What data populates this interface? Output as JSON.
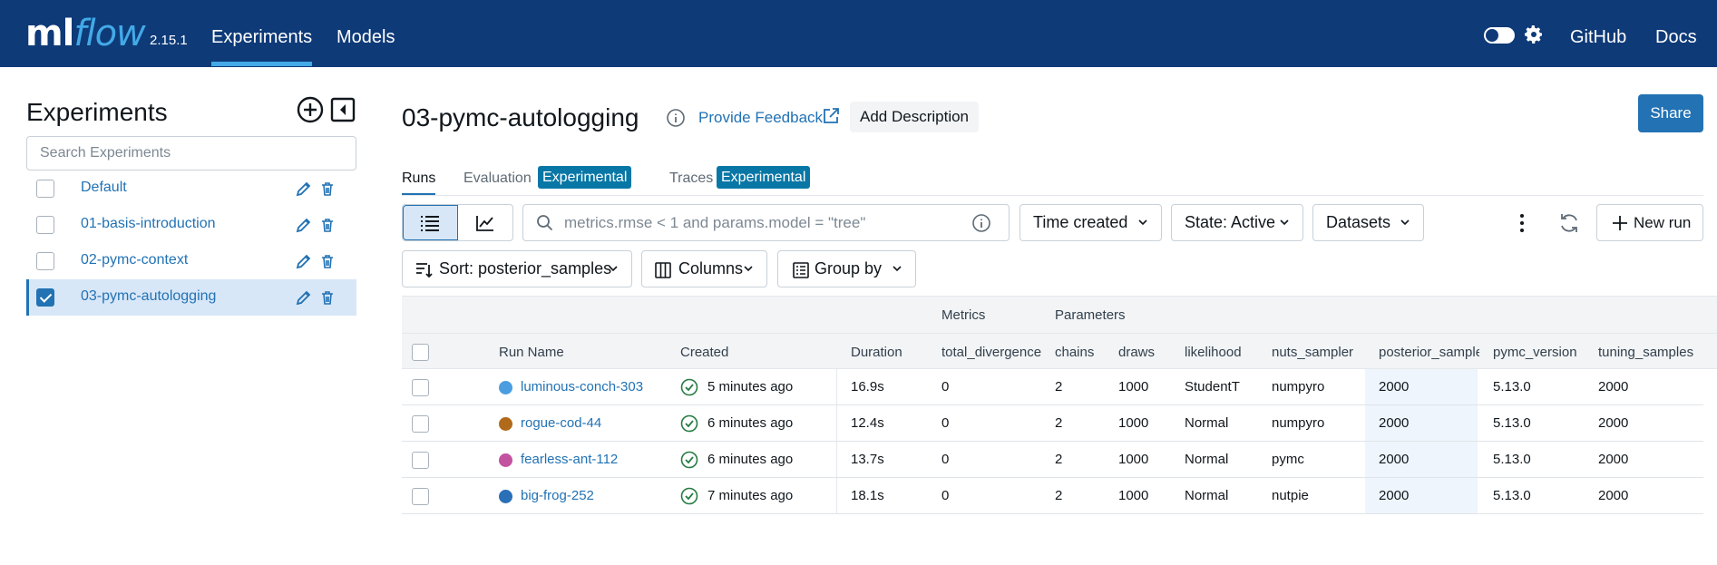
{
  "header": {
    "logo_ml": "ml",
    "logo_flow": "flow",
    "version": "2.15.1",
    "nav": [
      {
        "label": "Experiments",
        "active": true
      },
      {
        "label": "Models",
        "active": false
      }
    ],
    "links": [
      "GitHub",
      "Docs"
    ],
    "colors": {
      "bg": "#0e3a78",
      "accent": "#43a9e7"
    }
  },
  "sidebar": {
    "title": "Experiments",
    "search_placeholder": "Search Experiments",
    "experiments": [
      {
        "label": "Default",
        "checked": false
      },
      {
        "label": "01-basis-introduction",
        "checked": false
      },
      {
        "label": "02-pymc-context",
        "checked": false
      },
      {
        "label": "03-pymc-autologging",
        "checked": true
      }
    ]
  },
  "main": {
    "title": "03-pymc-autologging",
    "feedback_label": "Provide Feedback",
    "add_description_label": "Add Description",
    "share_label": "Share",
    "tabs": [
      {
        "label": "Runs",
        "active": true
      },
      {
        "label": "Evaluation",
        "badge": "Experimental"
      },
      {
        "label": "Traces",
        "badge": "Experimental"
      }
    ],
    "filter_placeholder": "metrics.rmse < 1 and params.model = \"tree\"",
    "time_created_label": "Time created",
    "state_label": "State: Active",
    "datasets_label": "Datasets",
    "new_run_label": "New run",
    "sort_label": "Sort: posterior_samples",
    "columns_label": "Columns",
    "group_by_label": "Group by"
  },
  "table": {
    "groups": {
      "metrics": "Metrics",
      "parameters": "Parameters"
    },
    "headers": {
      "run_name": "Run Name",
      "created": "Created",
      "duration": "Duration",
      "total_divergences": "total_divergences",
      "chains": "chains",
      "draws": "draws",
      "likelihood": "likelihood",
      "nuts_sampler": "nuts_sampler",
      "posterior_samples": "posterior_samples",
      "pymc_version": "pymc_version",
      "tuning_samples": "tuning_samples"
    },
    "rows": [
      {
        "name": "luminous-conch-303",
        "color": "#4a9ee0",
        "created": "5 minutes ago",
        "duration": "16.9s",
        "total_divergences": "0",
        "chains": "2",
        "draws": "1000",
        "likelihood": "StudentT",
        "nuts_sampler": "numpyro",
        "posterior_samples": "2000",
        "pymc_version": "5.13.0",
        "tuning_samples": "2000"
      },
      {
        "name": "rogue-cod-44",
        "color": "#b06a1a",
        "created": "6 minutes ago",
        "duration": "12.4s",
        "total_divergences": "0",
        "chains": "2",
        "draws": "1000",
        "likelihood": "Normal",
        "nuts_sampler": "numpyro",
        "posterior_samples": "2000",
        "pymc_version": "5.13.0",
        "tuning_samples": "2000"
      },
      {
        "name": "fearless-ant-112",
        "color": "#c3529f",
        "created": "6 minutes ago",
        "duration": "13.7s",
        "total_divergences": "0",
        "chains": "2",
        "draws": "1000",
        "likelihood": "Normal",
        "nuts_sampler": "pymc",
        "posterior_samples": "2000",
        "pymc_version": "5.13.0",
        "tuning_samples": "2000"
      },
      {
        "name": "big-frog-252",
        "color": "#2a6fb8",
        "created": "7 minutes ago",
        "duration": "18.1s",
        "total_divergences": "0",
        "chains": "2",
        "draws": "1000",
        "likelihood": "Normal",
        "nuts_sampler": "nutpie",
        "posterior_samples": "2000",
        "pymc_version": "5.13.0",
        "tuning_samples": "2000"
      }
    ]
  }
}
